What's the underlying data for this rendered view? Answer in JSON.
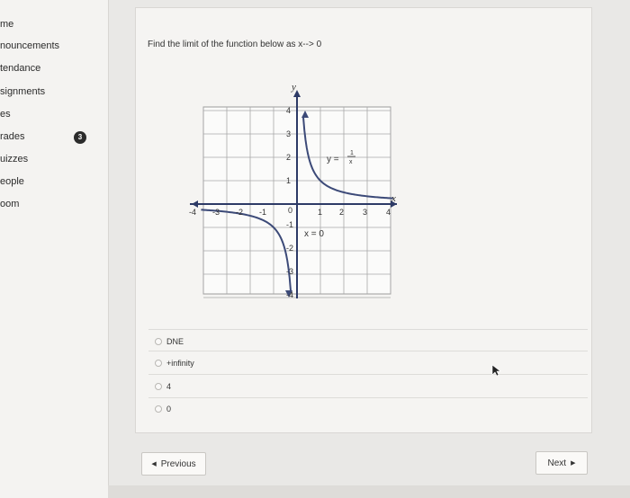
{
  "sidebar": {
    "items": [
      {
        "label": "me"
      },
      {
        "label": "nouncements"
      },
      {
        "label": "tendance"
      },
      {
        "label": "signments"
      },
      {
        "label": "es"
      },
      {
        "label": "rades"
      },
      {
        "label": "uizzes"
      },
      {
        "label": "eople"
      },
      {
        "label": "oom"
      }
    ],
    "badge_count": "3"
  },
  "question": {
    "text": "Find the limit of the function below as x--> 0"
  },
  "graph": {
    "axis_x_label": "x",
    "axis_y_label": "y",
    "x_ticks": [
      "-4",
      "-3",
      "-2",
      "-1",
      "0",
      "1",
      "2",
      "3",
      "4"
    ],
    "y_ticks": [
      "4",
      "3",
      "2",
      "1",
      "-1",
      "-2",
      "-3",
      "-4"
    ],
    "function_label_prefix": "y =",
    "function_numerator": "1",
    "function_denominator": "x",
    "asymptote_label": "x = 0",
    "curve_color": "#3c4a78",
    "axis_color": "#2d3a66"
  },
  "choices": [
    {
      "label": "DNE"
    },
    {
      "label": "+infinity"
    },
    {
      "label": "4"
    },
    {
      "label": "0"
    }
  ],
  "navigation": {
    "previous_label": "Previous",
    "next_label": "Next"
  }
}
